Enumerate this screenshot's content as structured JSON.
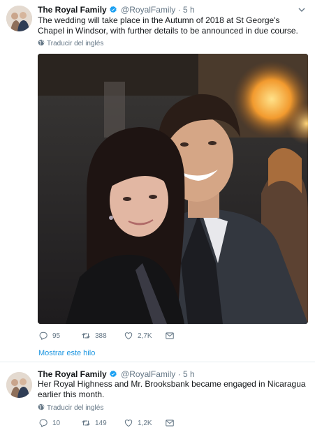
{
  "tweets": [
    {
      "name": "The Royal Family",
      "handle": "@RoyalFamily",
      "sep": "·",
      "time": "5 h",
      "text": "The wedding will take place in the Autumn of 2018 at St George's Chapel in Windsor, with further details to be announced in due course.",
      "translate": "Traducir del inglés",
      "replies": "95",
      "retweets": "388",
      "likes": "2,7K"
    },
    {
      "name": "The Royal Family",
      "handle": "@RoyalFamily",
      "sep": "·",
      "time": "5 h",
      "text": "Her Royal Highness and Mr. Brooksbank became engaged in Nicaragua earlier this month.",
      "translate": "Traducir del inglés",
      "replies": "10",
      "retweets": "149",
      "likes": "1,2K"
    }
  ],
  "show_thread": "Mostrar este hilo",
  "colors": {
    "link": "#1b95e0",
    "muted": "#657786",
    "verified": "#1da1f2"
  },
  "icons": [
    "verified-badge-icon",
    "chevron-down-icon",
    "globe-icon",
    "reply-icon",
    "retweet-icon",
    "like-icon",
    "direct-message-icon"
  ]
}
